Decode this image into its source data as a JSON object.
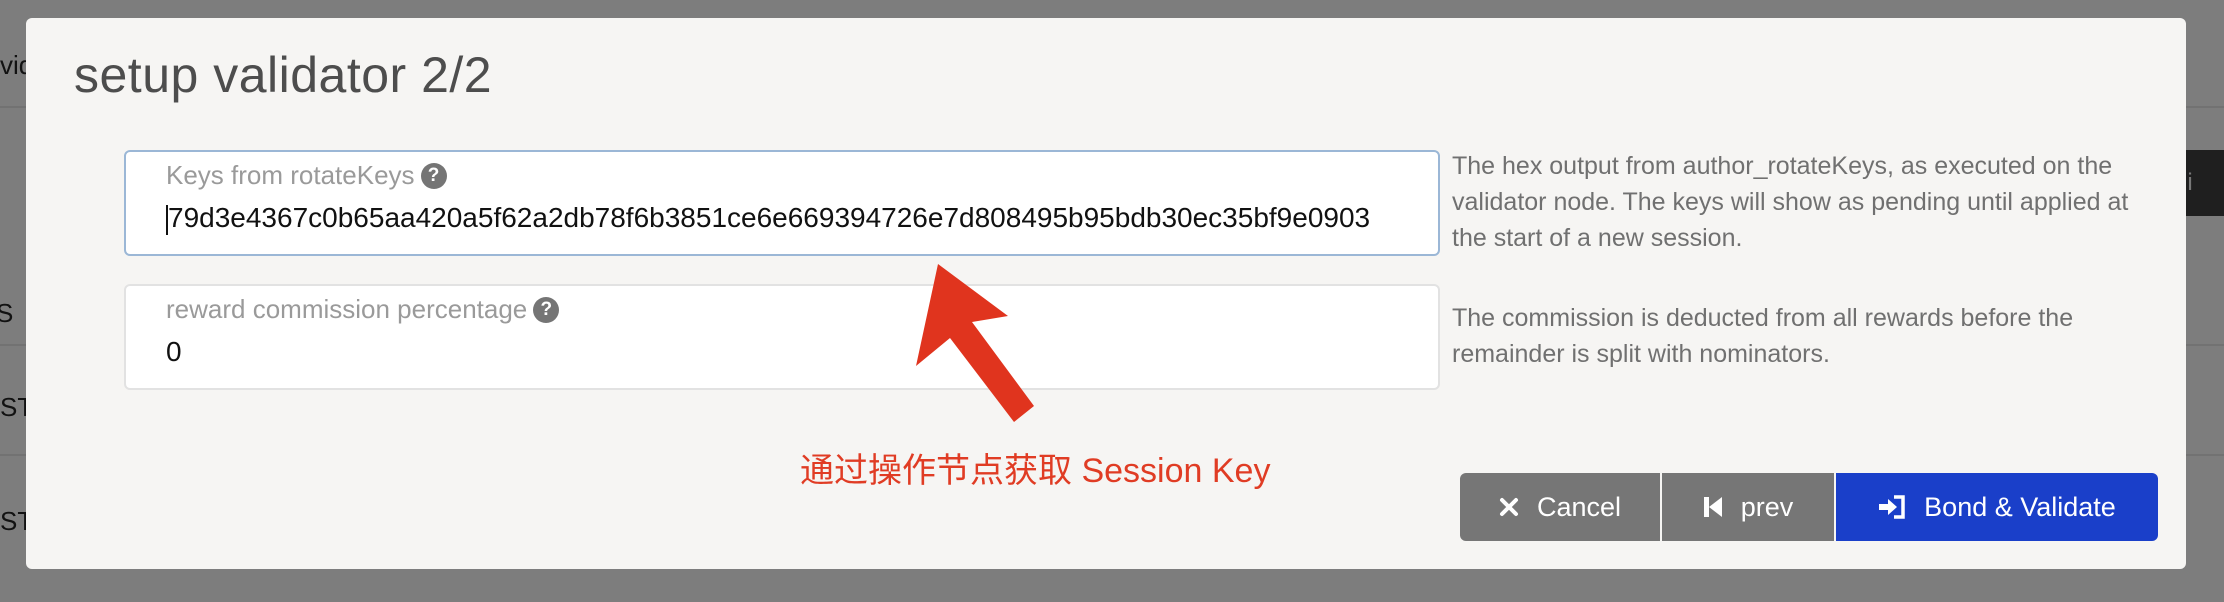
{
  "background": {
    "left_text_1": "vid",
    "left_text_2": "S",
    "left_text_3": "ST",
    "left_text_4": "ST",
    "right_button_text": "omi"
  },
  "modal": {
    "title": "setup validator 2/2",
    "keys_field": {
      "label": "Keys from rotateKeys",
      "value": "79d3e4367c0b65aa420a5f62a2db78f6b3851ce6e669394726e7d808495b95bdb30ec35bf9e0903",
      "help": "The hex output from author_rotateKeys, as executed on the validator node. The keys will show as pending until applied at the start of a new session."
    },
    "commission_field": {
      "label": "reward commission percentage",
      "value": "0",
      "help": "The commission is deducted from all rewards before the remainder is split with nominators."
    },
    "annotation": "通过操作节点获取 Session Key",
    "buttons": {
      "cancel": "Cancel",
      "prev": "prev",
      "bond": "Bond & Validate"
    }
  },
  "colors": {
    "accent": "#1a3fc9",
    "annotation": "#e03c24",
    "secondary_button": "#767676"
  }
}
